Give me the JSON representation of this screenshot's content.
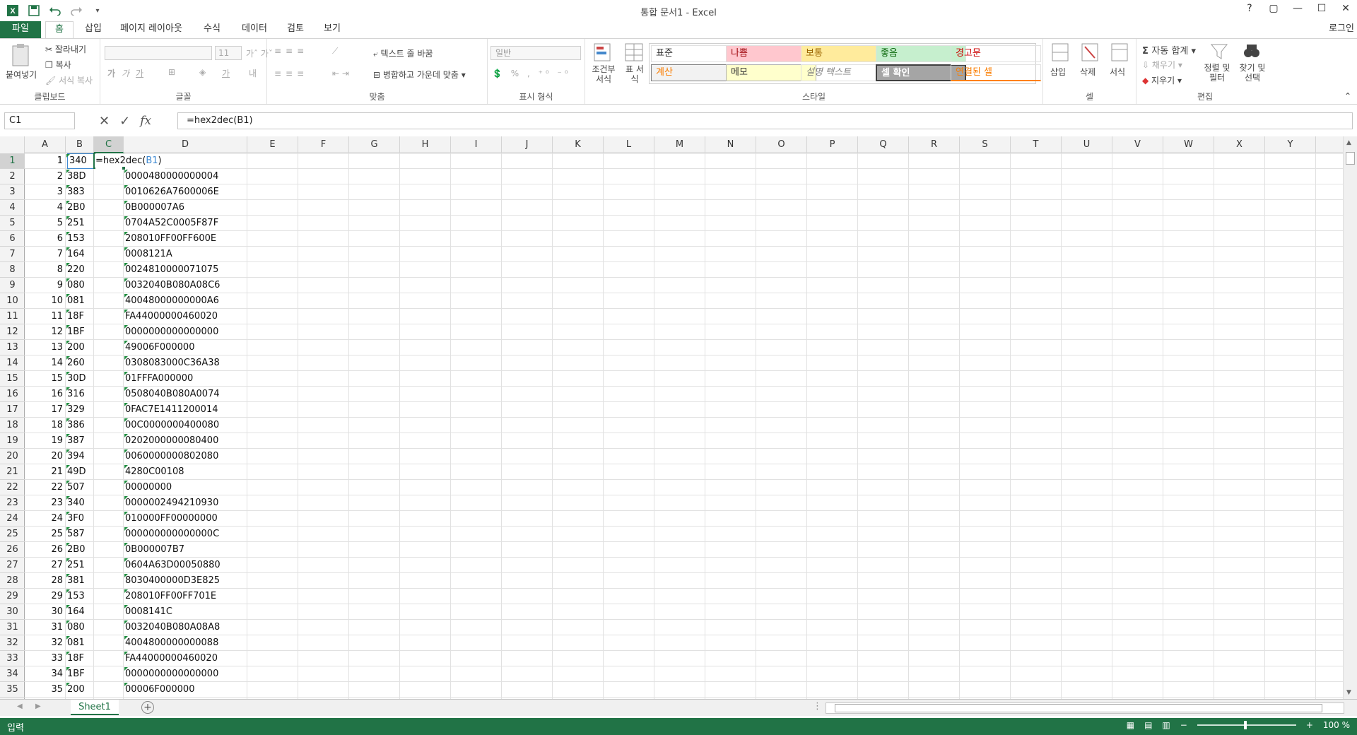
{
  "window": {
    "title": "통합 문서1 - Excel",
    "help_glyph": "?",
    "restore_glyph": "▢",
    "min_glyph": "—",
    "max_glyph": "☐",
    "close_glyph": "✕"
  },
  "tabs": {
    "file": "파일",
    "home": "홈",
    "insert": "삽입",
    "page_layout": "페이지 레이아웃",
    "formulas": "수식",
    "data": "데이터",
    "review": "검토",
    "view": "보기",
    "login": "로그인"
  },
  "ribbon": {
    "clipboard": {
      "paste": "붙여넣기",
      "cut": "잘라내기",
      "copy": "복사",
      "format_painter": "서식 복사",
      "label": "클립보드"
    },
    "font": {
      "label": "글꼴",
      "size": "11"
    },
    "alignment": {
      "wrap_text": "텍스트 줄 바꿈",
      "merge_center": "병합하고 가운데 맞춤",
      "label": "맞춤"
    },
    "number": {
      "format": "일반",
      "label": "표시 형식"
    },
    "styles": {
      "conditional": "조건부 서식",
      "table_format": "표 서식",
      "tiles": [
        "표준",
        "나쁨",
        "보통",
        "좋음",
        "경고문",
        "계산",
        "메모",
        "설명 텍스트",
        "셀 확인",
        "연결된 셀"
      ],
      "label": "스타일"
    },
    "cells": {
      "insert": "삽입",
      "delete": "삭제",
      "format": "서식",
      "label": "셀"
    },
    "editing": {
      "autosum": "자동 합계",
      "fill": "채우기",
      "clear": "지우기",
      "sort_filter": "정렬 및 필터",
      "find_select": "찾기 및 선택",
      "label": "편집"
    }
  },
  "formula_bar": {
    "name_box": "C1",
    "formula": "=hex2dec(B1)"
  },
  "grid": {
    "columns": [
      "A",
      "B",
      "C",
      "D",
      "E",
      "F",
      "G",
      "H",
      "I",
      "J",
      "K",
      "L",
      "M",
      "N",
      "O",
      "P",
      "Q",
      "R",
      "S",
      "T",
      "U",
      "V",
      "W",
      "X",
      "Y"
    ],
    "active_cell_prefix": "=hex2dec(",
    "active_cell_ref": "B1",
    "active_cell_suffix": ")",
    "rows": [
      {
        "a": "1",
        "b": "340",
        "d": ""
      },
      {
        "a": "2",
        "b": "38D",
        "d": "0000480000000004"
      },
      {
        "a": "3",
        "b": "383",
        "d": "0010626A7600006E"
      },
      {
        "a": "4",
        "b": "2B0",
        "d": "0B000007A6"
      },
      {
        "a": "5",
        "b": "251",
        "d": "0704A52C0005F87F"
      },
      {
        "a": "6",
        "b": "153",
        "d": "208010FF00FF600E"
      },
      {
        "a": "7",
        "b": "164",
        "d": "0008121A"
      },
      {
        "a": "8",
        "b": "220",
        "d": "0024810000071075"
      },
      {
        "a": "9",
        "b": "080",
        "d": "0032040B080A08C6"
      },
      {
        "a": "10",
        "b": "081",
        "d": "40048000000000A6"
      },
      {
        "a": "11",
        "b": "18F",
        "d": "FA44000000460020"
      },
      {
        "a": "12",
        "b": "1BF",
        "d": "0000000000000000"
      },
      {
        "a": "13",
        "b": "200",
        "d": "49006F000000"
      },
      {
        "a": "14",
        "b": "260",
        "d": "0308083000C36A38"
      },
      {
        "a": "15",
        "b": "30D",
        "d": "01FFFA000000"
      },
      {
        "a": "16",
        "b": "316",
        "d": "0508040B080A0074"
      },
      {
        "a": "17",
        "b": "329",
        "d": "0FAC7E1411200014"
      },
      {
        "a": "18",
        "b": "386",
        "d": "00C0000000400080"
      },
      {
        "a": "19",
        "b": "387",
        "d": "0202000000080400"
      },
      {
        "a": "20",
        "b": "394",
        "d": "0060000000802080"
      },
      {
        "a": "21",
        "b": "49D",
        "d": "4280C00108"
      },
      {
        "a": "22",
        "b": "507",
        "d": "00000000"
      },
      {
        "a": "23",
        "b": "340",
        "d": "0000002494210930"
      },
      {
        "a": "24",
        "b": "3F0",
        "d": "010000FF00000000"
      },
      {
        "a": "25",
        "b": "587",
        "d": "000000000000000C"
      },
      {
        "a": "26",
        "b": "2B0",
        "d": "0B000007B7"
      },
      {
        "a": "27",
        "b": "251",
        "d": "0604A63D00050880"
      },
      {
        "a": "28",
        "b": "381",
        "d": "8030400000D3E825"
      },
      {
        "a": "29",
        "b": "153",
        "d": "208010FF00FF701E"
      },
      {
        "a": "30",
        "b": "164",
        "d": "0008141C"
      },
      {
        "a": "31",
        "b": "080",
        "d": "0032040B080A08A8"
      },
      {
        "a": "32",
        "b": "081",
        "d": "4004800000000088"
      },
      {
        "a": "33",
        "b": "18F",
        "d": "FA44000000460020"
      },
      {
        "a": "34",
        "b": "1BF",
        "d": "0000000000000000"
      },
      {
        "a": "35",
        "b": "200",
        "d": "00006F000000"
      }
    ]
  },
  "sheets": {
    "active": "Sheet1"
  },
  "status": {
    "mode": "입력",
    "zoom": "100 %"
  },
  "colors": {
    "accent": "#217346",
    "reference": "#3f8ad2"
  }
}
